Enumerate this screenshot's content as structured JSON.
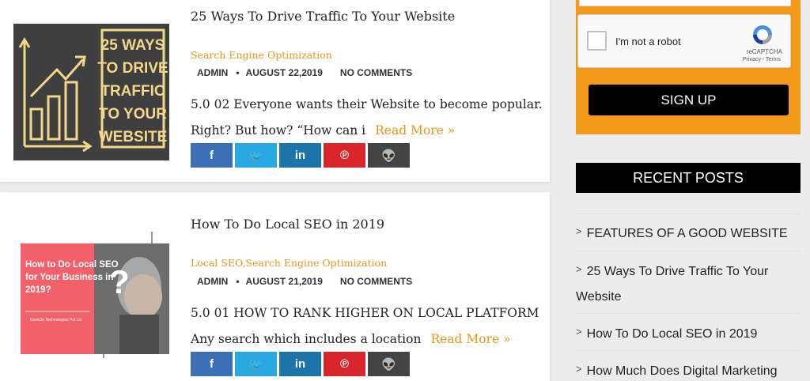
{
  "posts": [
    {
      "title": "25 Ways To Drive Traffic To Your Website",
      "category": "Search Engine Optimization",
      "author": "ADMIN",
      "date": "AUGUST 22,2019",
      "comments": "NO COMMENTS",
      "excerpt_line1": "5.0 02 Everyone wants their Website to become popular.",
      "excerpt_line2": "Right?  But how? “How can i",
      "read_more": "Read More »",
      "thumb_text": [
        "25 WAYS",
        "TO DRIVE",
        "TRAFFIC",
        "TO YOUR",
        "WEBSITE"
      ]
    },
    {
      "title": "How To Do Local SEO in 2019",
      "category": "Local SEO,Search Engine Optimization",
      "author": "ADMIN",
      "date": "AUGUST 21,2019",
      "comments": "NO COMMENTS",
      "excerpt_line1": "5.0 01 HOW TO RANK HIGHER ON LOCAL PLATFORM",
      "excerpt_line2": "Any search which includes a location",
      "read_more": "Read More »",
      "thumb_text": [
        "How to Do Local SEO",
        "for Your Business in",
        "2019?"
      ],
      "thumb_small": "RankDo Technologies Pvt Ltd"
    }
  ],
  "meta_separator": "•",
  "share": [
    {
      "label": "f",
      "icon": "facebook-icon",
      "color": "#3b6fb6"
    },
    {
      "label": "🐦",
      "icon": "twitter-icon",
      "color": "#29a9e1"
    },
    {
      "label": "in",
      "icon": "linkedin-icon",
      "color": "#1b75a8"
    },
    {
      "label": "℗",
      "icon": "pinterest-icon",
      "color": "#d9262c"
    },
    {
      "label": "👽",
      "icon": "reddit-icon",
      "color": "#444444"
    }
  ],
  "sidebar": {
    "captcha_label": "I'm not a robot",
    "captcha_brand": "reCAPTCHA",
    "captcha_links": "Privacy - Terms",
    "signup_label": "SIGN UP",
    "recent_title": "RECENT POSTS",
    "recent_posts": [
      "FEATURES OF A GOOD WEBSITE",
      "25 Ways To Drive Traffic To Your Website",
      "How To Do Local SEO in 2019",
      "How Much Does Digital Marketing"
    ]
  },
  "colors": {
    "accent": "#e8951a",
    "form_bg": "#f39a1b"
  }
}
